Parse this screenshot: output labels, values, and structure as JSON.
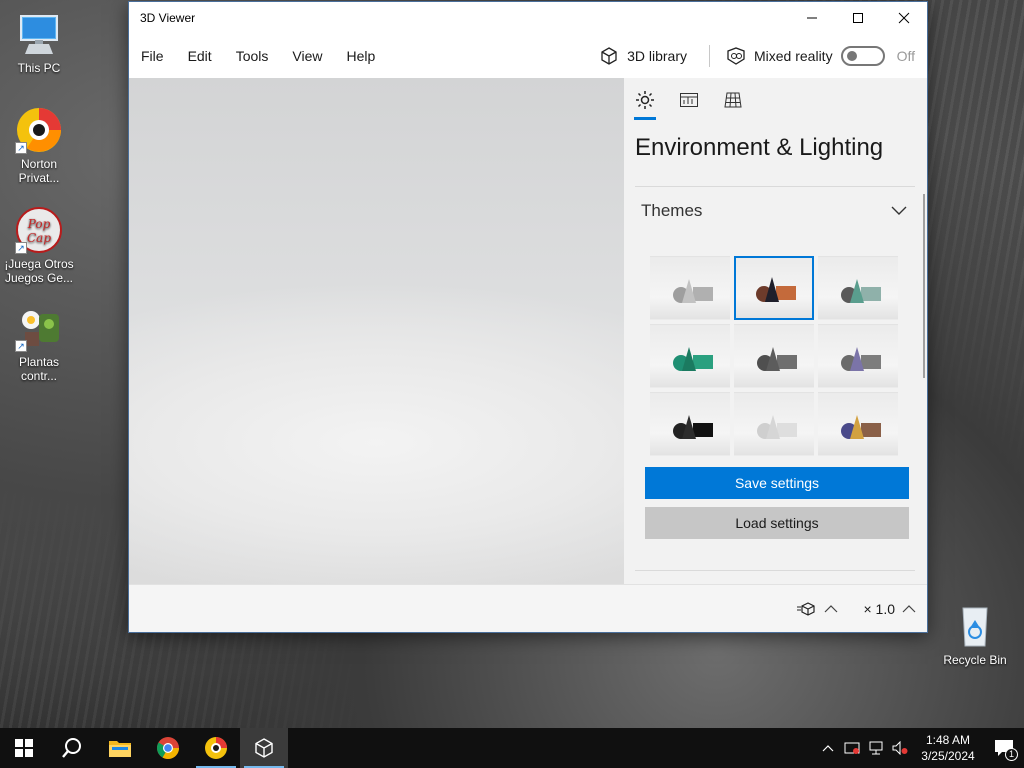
{
  "desktop": {
    "icons": [
      {
        "label": "This PC"
      },
      {
        "label": "Norton Privat..."
      },
      {
        "label": "¡Juega Otros Juegos Ge..."
      },
      {
        "label": "Plantas contr..."
      },
      {
        "label": "Recycle Bin"
      }
    ]
  },
  "window": {
    "title": "3D Viewer",
    "menu": [
      "File",
      "Edit",
      "Tools",
      "View",
      "Help"
    ],
    "library_label": "3D library",
    "mixed_reality_label": "Mixed reality",
    "mixed_reality_state": "Off"
  },
  "panel": {
    "title": "Environment & Lighting",
    "section": "Themes",
    "save_label": "Save settings",
    "load_label": "Load settings",
    "selected_theme_index": 1
  },
  "status": {
    "scale": "× 1.0"
  },
  "taskbar": {
    "time": "1:48 AM",
    "date": "3/25/2024",
    "notifications": "1"
  },
  "colors": {
    "accent": "#0078d7",
    "taskbar": "#101010"
  }
}
